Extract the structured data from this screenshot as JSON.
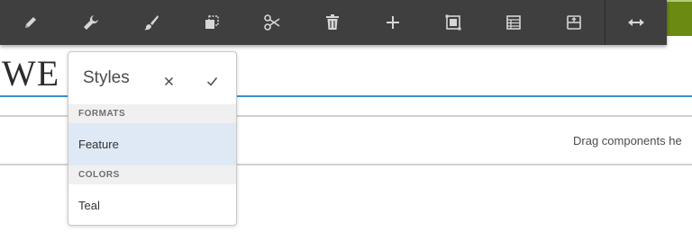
{
  "toolbar": {
    "buttons": [
      {
        "name": "edit",
        "icon": "pencil-icon"
      },
      {
        "name": "configure",
        "icon": "wrench-icon"
      },
      {
        "name": "styles",
        "icon": "brush-icon"
      },
      {
        "name": "copy",
        "icon": "copy-icon"
      },
      {
        "name": "cut",
        "icon": "scissors-icon"
      },
      {
        "name": "delete",
        "icon": "trash-icon"
      },
      {
        "name": "insert",
        "icon": "plus-icon"
      },
      {
        "name": "group",
        "icon": "group-icon"
      },
      {
        "name": "layout",
        "icon": "table-icon"
      },
      {
        "name": "parent",
        "icon": "parent-icon"
      },
      {
        "name": "resize",
        "icon": "resize-arrows-icon"
      }
    ]
  },
  "page": {
    "heading": "WE",
    "drag_hint": "Drag components he"
  },
  "styles_popover": {
    "title": "Styles",
    "sections": [
      {
        "label": "FORMATS",
        "items": [
          {
            "label": "Feature",
            "selected": true
          }
        ]
      },
      {
        "label": "COLORS",
        "items": [
          {
            "label": "Teal",
            "selected": false
          }
        ]
      }
    ]
  },
  "colors": {
    "toolbar_bg": "#3f3f3f",
    "accent_blue": "#3d8fd0",
    "selected_bg": "#dfe8f5",
    "green": "#6a8a12"
  }
}
